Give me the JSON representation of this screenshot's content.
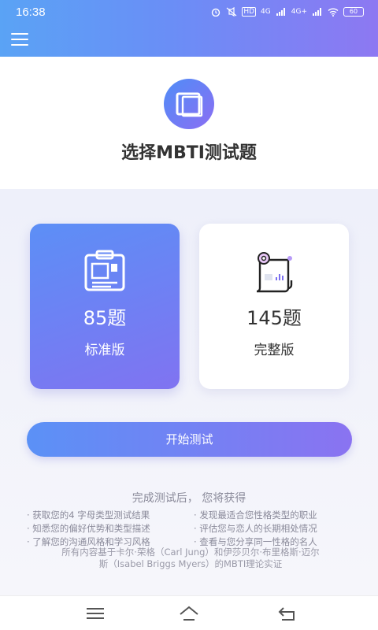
{
  "status_bar": {
    "time": "16:38",
    "signal1": "4G",
    "signal2": "4G+",
    "hd": "HD",
    "battery": "60"
  },
  "app_bar": {
    "menu_icon": "hamburger-menu-icon"
  },
  "header": {
    "logo_icon": "book-frame-icon",
    "title": "选择MBTI测试题"
  },
  "cards": [
    {
      "count": "85题",
      "edition": "标准版",
      "icon": "clipboard-icon",
      "selected": true
    },
    {
      "count": "145题",
      "edition": "完整版",
      "icon": "scroll-icon",
      "selected": false
    }
  ],
  "start_button": "开始测试",
  "benefits": {
    "title": "完成测试后， 您将获得",
    "items": [
      "· 获取您的4 字母类型测试结果",
      "· 发现最适合您性格类型的职业",
      "· 知悉您的偏好优势和类型描述",
      "· 评估您与恋人的长期相处情况",
      "· 了解您的沟通风格和学习风格",
      "· 查看与您分享同一性格的名人"
    ]
  },
  "footnote": {
    "line1": "所有内容基于卡尔·荣格（Carl Jung）和伊莎贝尔·布里格斯·迈尔",
    "line2": "斯（Isabel Briggs Myers）的MBTI理论实证"
  },
  "nav_bar": {
    "menu": "menu-icon",
    "home": "home-icon",
    "back": "back-icon"
  },
  "colors": {
    "accent_start": "#5b91f6",
    "accent_end": "#8a73f1",
    "page_bg": "#f4f5fb",
    "muted_text": "#8a8a9a"
  }
}
